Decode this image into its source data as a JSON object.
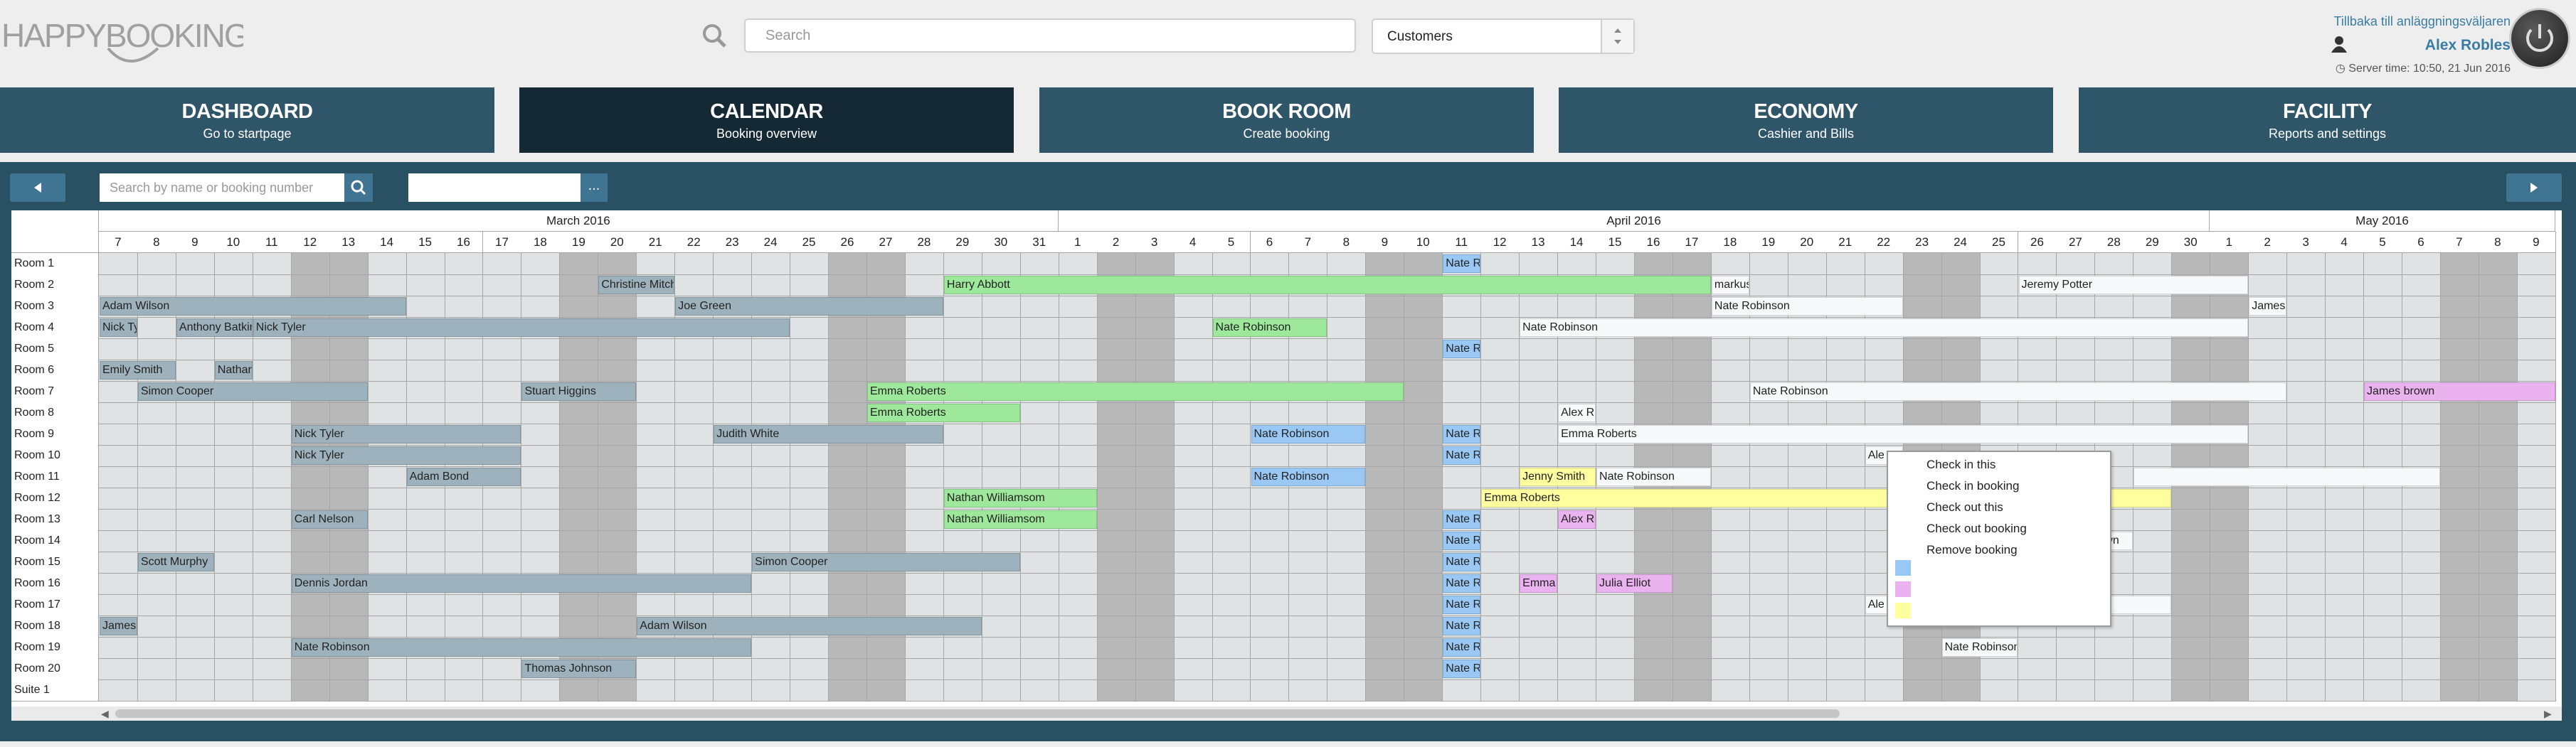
{
  "app": {
    "logo_text": "HAPPYBOOKING"
  },
  "header": {
    "search_placeholder": "Search",
    "customer_select": "Customers",
    "back_link": "Tillbaka till anläggningsväljaren",
    "user_name": "Alex Robles",
    "server_time": "Server time: 10:50, 21 Jun 2016"
  },
  "nav": [
    {
      "title": "DASHBOARD",
      "subtitle": "Go to startpage"
    },
    {
      "title": "CALENDAR",
      "subtitle": "Booking overview"
    },
    {
      "title": "BOOK ROOM",
      "subtitle": "Create booking"
    },
    {
      "title": "ECONOMY",
      "subtitle": "Cashier and Bills"
    },
    {
      "title": "FACILITY",
      "subtitle": "Reports and settings"
    }
  ],
  "toolbar": {
    "booking_search_placeholder": "Search by name or booking number",
    "date_button": "..."
  },
  "colors": {
    "grey": "#9eb2bd",
    "green": "#9ee89b",
    "blue": "#99c8f4",
    "white": "#f7f8fa",
    "pink": "#eab3f0",
    "yellow": "#ffff9f"
  },
  "calendar": {
    "months": [
      {
        "label": "March 2016",
        "days": [
          7,
          8,
          9,
          10,
          11,
          12,
          13,
          14,
          15,
          16,
          17,
          18,
          19,
          20,
          21,
          22,
          23,
          24,
          25,
          26,
          27,
          28,
          29,
          30,
          31
        ]
      },
      {
        "label": "April 2016",
        "days": [
          1,
          2,
          3,
          4,
          5,
          6,
          7,
          8,
          9,
          10,
          11,
          12,
          13,
          14,
          15,
          16,
          17,
          18,
          19,
          20,
          21,
          22,
          23,
          24,
          25,
          26,
          27,
          28,
          29,
          30
        ]
      },
      {
        "label": "May 2016",
        "days": [
          1,
          2,
          3,
          4,
          5,
          6,
          7,
          8,
          9
        ]
      }
    ],
    "weekend_columns": [
      5,
      6,
      12,
      13,
      19,
      20,
      26,
      27,
      33,
      34,
      40,
      41,
      47,
      48,
      54,
      55,
      61,
      62
    ],
    "rooms": [
      "Room 1",
      "Room 2",
      "Room 3",
      "Room 4",
      "Room 5",
      "Room 6",
      "Room 7",
      "Room 8",
      "Room 9",
      "Room 10",
      "Room 11",
      "Room 12",
      "Room 13",
      "Room 14",
      "Room 15",
      "Room 16",
      "Room 17",
      "Room 18",
      "Room 19",
      "Room 20",
      "Suite 1"
    ],
    "bookings": [
      {
        "room": 0,
        "start": 35,
        "span": 1,
        "name": "Nate R",
        "color": "blue"
      },
      {
        "room": 1,
        "start": 13,
        "span": 2,
        "name": "Christine Mitch",
        "color": "grey"
      },
      {
        "room": 1,
        "start": 22,
        "span": 20,
        "name": "Harry Abbott",
        "color": "green"
      },
      {
        "room": 1,
        "start": 42,
        "span": 1,
        "name": "markus",
        "color": "white"
      },
      {
        "room": 1,
        "start": 50,
        "span": 6,
        "name": "Jeremy Potter",
        "color": "white"
      },
      {
        "room": 2,
        "start": 0,
        "span": 8,
        "name": "Adam Wilson",
        "color": "grey"
      },
      {
        "room": 2,
        "start": 15,
        "span": 7,
        "name": "Joe Green",
        "color": "grey"
      },
      {
        "room": 2,
        "start": 42,
        "span": 5,
        "name": "Nate Robinson",
        "color": "white"
      },
      {
        "room": 2,
        "start": 56,
        "span": 1,
        "name": "James",
        "color": "white"
      },
      {
        "room": 3,
        "start": 0,
        "span": 1,
        "name": "Nick Ty",
        "color": "grey"
      },
      {
        "room": 3,
        "start": 2,
        "span": 2,
        "name": "Anthony Batkin",
        "color": "grey"
      },
      {
        "room": 3,
        "start": 4,
        "span": 14,
        "name": "Nick Tyler",
        "color": "grey"
      },
      {
        "room": 3,
        "start": 29,
        "span": 3,
        "name": "Nate Robinson",
        "color": "green"
      },
      {
        "room": 3,
        "start": 37,
        "span": 19,
        "name": "Nate Robinson",
        "color": "white"
      },
      {
        "room": 4,
        "start": 35,
        "span": 1,
        "name": "Nate R",
        "color": "blue"
      },
      {
        "room": 5,
        "start": 0,
        "span": 2,
        "name": "Emily Smith",
        "color": "grey"
      },
      {
        "room": 5,
        "start": 3,
        "span": 1,
        "name": "Nathan",
        "color": "grey"
      },
      {
        "room": 6,
        "start": 1,
        "span": 6,
        "name": "Simon Cooper",
        "color": "grey"
      },
      {
        "room": 6,
        "start": 11,
        "span": 3,
        "name": "Stuart Higgins",
        "color": "grey"
      },
      {
        "room": 6,
        "start": 20,
        "span": 14,
        "name": "Emma Roberts",
        "color": "green"
      },
      {
        "room": 6,
        "start": 43,
        "span": 14,
        "name": "Nate Robinson",
        "color": "white"
      },
      {
        "room": 6,
        "start": 59,
        "span": 5,
        "name": "James brown",
        "color": "pink"
      },
      {
        "room": 7,
        "start": 20,
        "span": 4,
        "name": "Emma Roberts",
        "color": "green"
      },
      {
        "room": 7,
        "start": 38,
        "span": 1,
        "name": "Alex R",
        "color": "white"
      },
      {
        "room": 8,
        "start": 5,
        "span": 6,
        "name": "Nick Tyler",
        "color": "grey"
      },
      {
        "room": 8,
        "start": 16,
        "span": 6,
        "name": "Judith White",
        "color": "grey"
      },
      {
        "room": 8,
        "start": 30,
        "span": 3,
        "name": "Nate Robinson",
        "color": "blue"
      },
      {
        "room": 8,
        "start": 35,
        "span": 1,
        "name": "Nate R",
        "color": "blue"
      },
      {
        "room": 8,
        "start": 38,
        "span": 18,
        "name": "Emma Roberts",
        "color": "white"
      },
      {
        "room": 9,
        "start": 5,
        "span": 6,
        "name": "Nick Tyler",
        "color": "grey"
      },
      {
        "room": 9,
        "start": 35,
        "span": 1,
        "name": "Nate R",
        "color": "blue"
      },
      {
        "room": 9,
        "start": 46,
        "span": 1,
        "name": "Ale",
        "color": "white"
      },
      {
        "room": 10,
        "start": 8,
        "span": 3,
        "name": "Adam Bond",
        "color": "grey"
      },
      {
        "room": 10,
        "start": 30,
        "span": 3,
        "name": "Nate Robinson",
        "color": "blue"
      },
      {
        "room": 10,
        "start": 37,
        "span": 2,
        "name": "Jenny Smith",
        "color": "yellow"
      },
      {
        "room": 10,
        "start": 39,
        "span": 3,
        "name": "Nate Robinson",
        "color": "white"
      },
      {
        "room": 10,
        "start": 53,
        "span": 8,
        "name": "",
        "color": "white"
      },
      {
        "room": 11,
        "start": 22,
        "span": 4,
        "name": "Nathan Williamsom",
        "color": "green"
      },
      {
        "room": 11,
        "start": 36,
        "span": 18,
        "name": "Emma Roberts",
        "color": "yellow"
      },
      {
        "room": 12,
        "start": 5,
        "span": 2,
        "name": "Carl Nelson",
        "color": "grey"
      },
      {
        "room": 12,
        "start": 22,
        "span": 4,
        "name": "Nathan Williamsom",
        "color": "green"
      },
      {
        "room": 12,
        "start": 35,
        "span": 1,
        "name": "Nate R",
        "color": "blue"
      },
      {
        "room": 12,
        "start": 38,
        "span": 1,
        "name": "Alex Ro",
        "color": "pink"
      },
      {
        "room": 13,
        "start": 35,
        "span": 1,
        "name": "Nate R",
        "color": "blue"
      },
      {
        "room": 13,
        "start": 52,
        "span": 1,
        "name": "own",
        "color": "white"
      },
      {
        "room": 14,
        "start": 1,
        "span": 2,
        "name": "Scott Murphy",
        "color": "grey"
      },
      {
        "room": 14,
        "start": 17,
        "span": 7,
        "name": "Simon Cooper",
        "color": "grey"
      },
      {
        "room": 14,
        "start": 35,
        "span": 1,
        "name": "Nate R",
        "color": "blue"
      },
      {
        "room": 15,
        "start": 5,
        "span": 12,
        "name": "Dennis Jordan",
        "color": "grey"
      },
      {
        "room": 15,
        "start": 35,
        "span": 1,
        "name": "Nate R",
        "color": "blue"
      },
      {
        "room": 15,
        "start": 37,
        "span": 1,
        "name": "Emma",
        "color": "pink"
      },
      {
        "room": 15,
        "start": 39,
        "span": 2,
        "name": "Julia Elliot",
        "color": "pink"
      },
      {
        "room": 16,
        "start": 35,
        "span": 1,
        "name": "Nate R",
        "color": "blue"
      },
      {
        "room": 16,
        "start": 46,
        "span": 8,
        "name": "Ale",
        "color": "white"
      },
      {
        "room": 17,
        "start": 0,
        "span": 1,
        "name": "James",
        "color": "grey"
      },
      {
        "room": 17,
        "start": 14,
        "span": 9,
        "name": "Adam Wilson",
        "color": "grey"
      },
      {
        "room": 17,
        "start": 35,
        "span": 1,
        "name": "Nate R",
        "color": "blue"
      },
      {
        "room": 18,
        "start": 5,
        "span": 12,
        "name": "Nate Robinson",
        "color": "grey"
      },
      {
        "room": 18,
        "start": 35,
        "span": 1,
        "name": "Nate R",
        "color": "blue"
      },
      {
        "room": 18,
        "start": 48,
        "span": 2,
        "name": "Nate Robinson",
        "color": "white"
      },
      {
        "room": 19,
        "start": 11,
        "span": 3,
        "name": "Thomas Johnson",
        "color": "grey"
      },
      {
        "room": 19,
        "start": 35,
        "span": 1,
        "name": "Nate R",
        "color": "blue"
      }
    ]
  },
  "context_menu": {
    "items": [
      "Check in this",
      "Check in booking",
      "Check out this",
      "Check out booking",
      "Remove booking"
    ],
    "swatches": [
      "blue",
      "pink",
      "yellow"
    ]
  }
}
